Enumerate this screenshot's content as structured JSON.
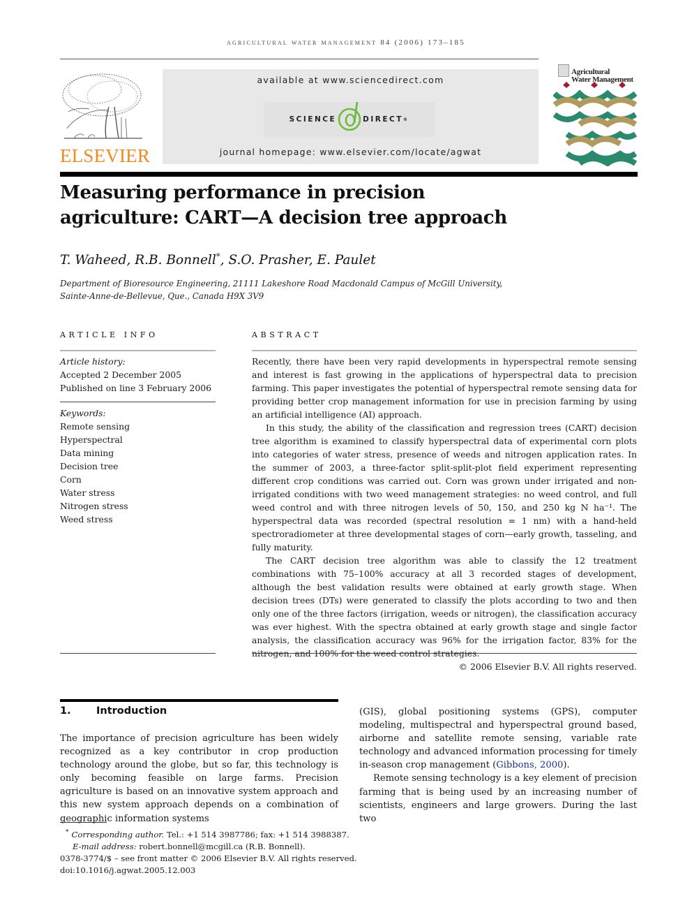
{
  "running_head": "agricultural water management 84 (2006) 173–185",
  "header": {
    "publisher_logo_text": "ELSEVIER",
    "available_at": "available at www.sciencedirect.com",
    "sd_logo": {
      "left": "SCIENCE",
      "at": "d",
      "right": "DIRECT",
      "reg": "®"
    },
    "journal_homepage": "journal homepage: www.elsevier.com/locate/agwat",
    "cover_title_line1": "Agricultural",
    "cover_title_line2": "Water Management",
    "colors": {
      "elsevier_orange": "#f08a1d",
      "sd_green": "#6cbd3f",
      "cover_teal": "#2a8a6e",
      "cover_gold": "#b09a5e",
      "cover_red": "#a01f2d"
    }
  },
  "article": {
    "title_line1": "Measuring performance in precision",
    "title_line2": "agriculture: CART—A decision tree approach",
    "authors_before": "T. Waheed, R.B. Bonnell",
    "author_mark": "*",
    "authors_after": ", S.O. Prasher, E. Paulet",
    "affiliation_line1": "Department of Bioresource Engineering, 21111 Lakeshore Road Macdonald Campus of McGill University,",
    "affiliation_line2": "Sainte-Anne-de-Bellevue, Que., Canada H9X 3V9"
  },
  "article_info": {
    "label": "ARTICLE INFO",
    "history_label": "Article history:",
    "accepted": "Accepted 2 December 2005",
    "published": "Published on line 3 February 2006",
    "keywords_label": "Keywords:",
    "keywords": [
      "Remote sensing",
      "Hyperspectral",
      "Data mining",
      "Decision tree",
      "Corn",
      "Water stress",
      "Nitrogen stress",
      "Weed stress"
    ]
  },
  "abstract": {
    "label": "ABSTRACT",
    "paragraphs": [
      "Recently, there have been very rapid developments in hyperspectral remote sensing and interest is fast growing in the applications of hyperspectral data to precision farming. This paper investigates the potential of hyperspectral remote sensing data for providing better crop management information for use in precision farming by using an artificial intelligence (AI) approach.",
      "In this study, the ability of the classification and regression trees (CART) decision tree algorithm is examined to classify hyperspectral data of experimental corn plots into categories of water stress, presence of weeds and nitrogen application rates. In the summer of 2003, a three-factor split-split-plot field experiment representing different crop conditions was carried out. Corn was grown under irrigated and non-irrigated conditions with two weed management strategies: no weed control, and full weed control and with three nitrogen levels of 50, 150, and 250 kg N ha⁻¹. The hyperspectral data was recorded (spectral resolution = 1 nm) with a hand-held spectroradiometer at three developmental stages of corn—early growth, tasseling, and fully maturity.",
      "The CART decision tree algorithm was able to classify the 12 treatment combinations with 75–100% accuracy at all 3 recorded stages of development, although the best validation results were obtained at early growth stage. When decision trees (DTs) were generated to classify the plots according to two and then only one of the three factors (irrigation, weeds or nitrogen), the classification accuracy was ever highest. With the spectra obtained at early growth stage and single factor analysis, the classification accuracy was 96% for the irrigation factor, 83% for the nitrogen, and 100% for the weed control strategies."
    ],
    "copyright": "© 2006 Elsevier B.V. All rights reserved."
  },
  "introduction": {
    "number": "1.",
    "heading": "Introduction",
    "left_paragraph": "The importance of precision agriculture has been widely recognized as a key contributor in crop production technology around the globe, but so far, this technology is only becoming feasible on large farms. Precision agriculture is based on an innovative system approach and this new system approach depends on a combination of geographic information systems",
    "right_paragraph1_before": "(GIS), global positioning systems (GPS), computer modeling, multispectral and hyperspectral ground based, airborne and satellite remote sensing, variable rate technology and advanced information processing for timely in-season crop management (",
    "right_paragraph1_cite": "Gibbons, 2000",
    "right_paragraph1_after": ").",
    "right_paragraph2": "Remote sensing technology is a key element of precision farming that is being used by an increasing number of scientists, engineers and large growers. During the last two"
  },
  "footnotes": {
    "mark": "*",
    "corresponding_label": "Corresponding author.",
    "corresponding_text": " Tel.: +1 514 3987786; fax: +1 514 3988387.",
    "email_label": "E-mail address:",
    "email_text": " robert.bonnell@mcgill.ca (R.B. Bonnell).",
    "front_matter": "0378-3774/$ – see front matter © 2006 Elsevier B.V. All rights reserved.",
    "doi": "doi:10.1016/j.agwat.2005.12.003"
  }
}
